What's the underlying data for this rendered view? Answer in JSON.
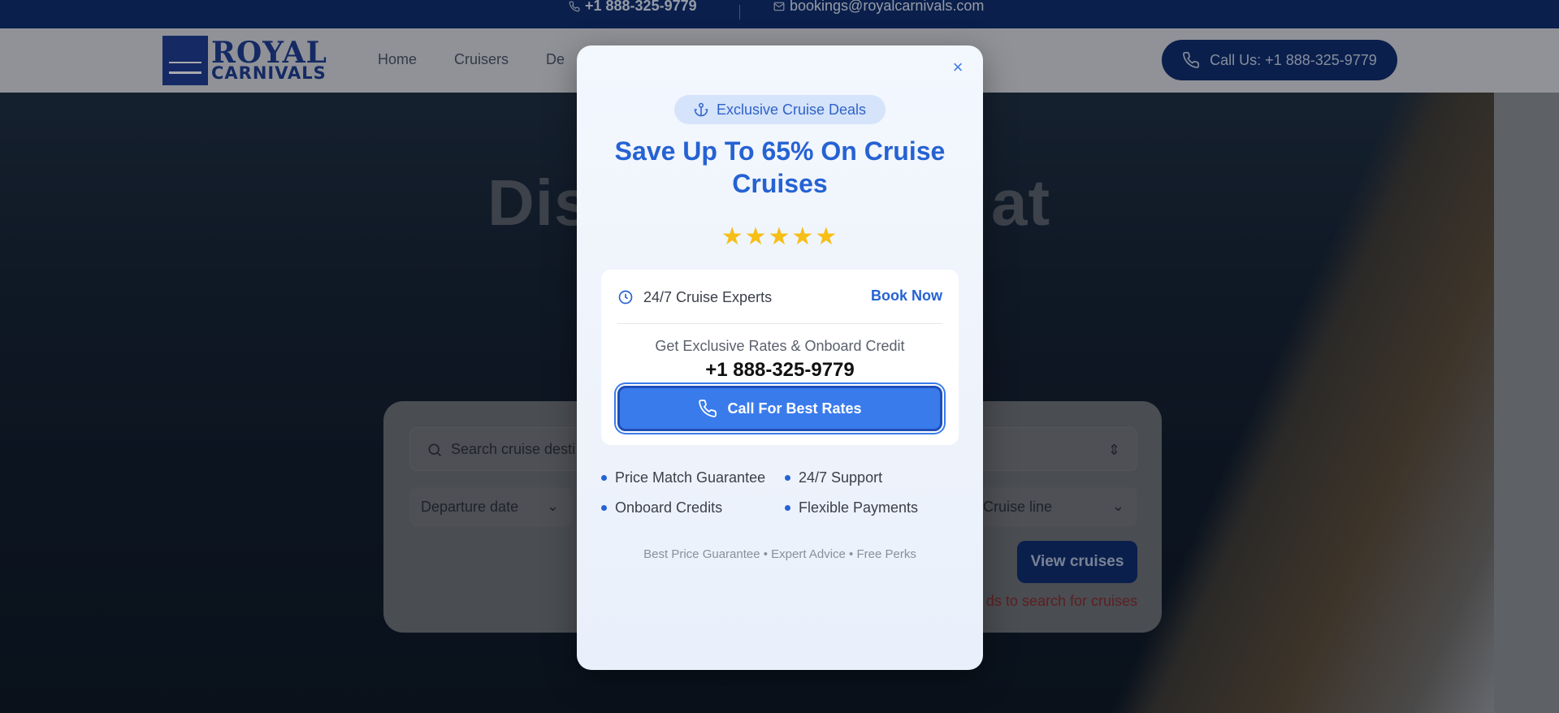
{
  "topbar": {
    "phone": "+1 888-325-9779",
    "email": "bookings@royalcarnivals.com"
  },
  "header": {
    "logo_line1": "ROYAL",
    "logo_line2": "CARNIVALS",
    "nav": [
      "Home",
      "Cruisers",
      "De"
    ],
    "call_button": "Call Us: +1 888-325-9779"
  },
  "hero": {
    "title_left": "Dis",
    "title_right": "at",
    "search_placeholder": "Search cruise desti",
    "departure_label": "Departure date",
    "cruise_line_label": "Cruise line",
    "view_button": "View cruises",
    "warning": "ds to search for cruises"
  },
  "modal": {
    "pill": "Exclusive Cruise Deals",
    "title": "Save Up To 65% On Cruise Cruises",
    "stars": "★★★★★",
    "rating_value": 5,
    "experts": "24/7 Cruise Experts",
    "book_now": "Book Now",
    "subtext": "Get Exclusive Rates & Onboard Credit",
    "phone": "+1 888-325-9779",
    "cta": "Call For Best Rates",
    "features": [
      "Price Match Guarantee",
      "24/7 Support",
      "Onboard Credits",
      "Flexible Payments"
    ],
    "footer": "Best Price Guarantee • Expert Advice • Free Perks",
    "close": "×"
  },
  "colors": {
    "brand_navy": "#0c2a6b",
    "accent_blue": "#2562d3",
    "cta_blue": "#3a7bec",
    "star_gold": "#f6be16"
  }
}
